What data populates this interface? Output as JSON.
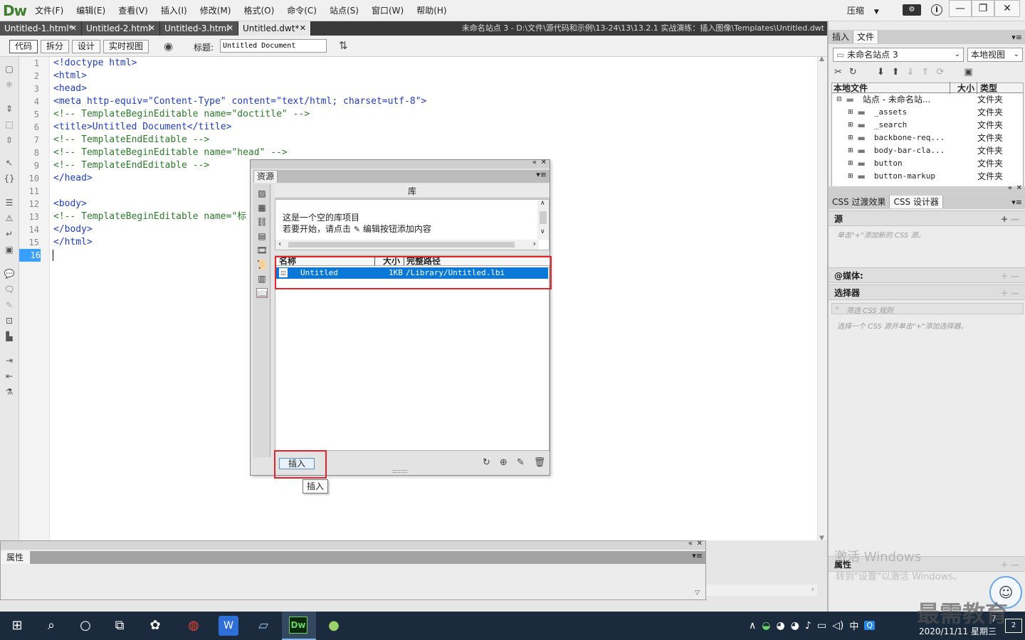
{
  "app": {
    "logo": "Dw",
    "menu": [
      "文件(F)",
      "编辑(E)",
      "查看(V)",
      "插入(I)",
      "修改(M)",
      "格式(O)",
      "命令(C)",
      "站点(S)",
      "窗口(W)",
      "帮助(H)"
    ],
    "compress_label": "压缩",
    "window_buttons": [
      "—",
      "❐",
      "✕"
    ]
  },
  "tabs": [
    {
      "label": "Untitled-1.html*"
    },
    {
      "label": "Untitled-2.html"
    },
    {
      "label": "Untitled-3.html"
    },
    {
      "label": "Untitled.dwt*"
    }
  ],
  "path_info": "未命名站点 3 - D:\\文件\\源代码和示例\\13-24\\13\\13.2.1  实战演练：插入图像\\Templates\\Untitled.dwt",
  "doc_toolbar": {
    "views": [
      "代码",
      "拆分",
      "设计",
      "实时视图"
    ],
    "title_label": "标题:",
    "title_value": "Untitled Document"
  },
  "code_lines": [
    {
      "n": "1",
      "text": "<!doctype html>",
      "kind": "t"
    },
    {
      "n": "2",
      "text": "<html>",
      "kind": "t"
    },
    {
      "n": "3",
      "text": "<head>",
      "kind": "t"
    },
    {
      "n": "4",
      "text": "<meta http-equiv=\"Content-Type\" content=\"text/html; charset=utf-8\">",
      "kind": "t"
    },
    {
      "n": "5",
      "text": "<!-- TemplateBeginEditable name=\"doctitle\" -->",
      "kind": "c"
    },
    {
      "n": "6",
      "text": "<title>Untitled Document</title>",
      "kind": "t"
    },
    {
      "n": "7",
      "text": "<!-- TemplateEndEditable -->",
      "kind": "c"
    },
    {
      "n": "8",
      "text": "<!-- TemplateBeginEditable name=\"head\" -->",
      "kind": "c"
    },
    {
      "n": "9",
      "text": "<!-- TemplateEndEditable -->",
      "kind": "c"
    },
    {
      "n": "10",
      "text": "</head>",
      "kind": "t"
    },
    {
      "n": "11",
      "text": "",
      "kind": "t"
    },
    {
      "n": "12",
      "text": "<body>",
      "kind": "t"
    },
    {
      "n": "13",
      "text": "<!-- TemplateBeginEditable name=\"标",
      "kind": "c"
    },
    {
      "n": "14",
      "text": "</body>",
      "kind": "t"
    },
    {
      "n": "15",
      "text": "</html>",
      "kind": "t"
    },
    {
      "n": "16",
      "text": "",
      "kind": "t"
    }
  ],
  "properties_panel": {
    "tab": "属性"
  },
  "assets_panel": {
    "tab": "资源",
    "library_header": "库",
    "preview_line1": "这是一个空的库项目",
    "preview_line2a": "若要开始，请点击",
    "preview_line2b": "编辑按钮添加内容",
    "columns": [
      "名称",
      "大小",
      "完整路径"
    ],
    "item": {
      "name": "Untitled",
      "size": "1KB",
      "path": "/Library/Untitled.lbi"
    },
    "insert_button": "插入",
    "tooltip": "插入"
  },
  "right_panel": {
    "tabs": [
      "插入",
      "文件"
    ],
    "site_select": "未命名站点 3",
    "view_select": "本地视图",
    "file_columns": [
      "本地文件",
      "大小",
      "类型"
    ],
    "root": {
      "name": "站点 - 未命名站...",
      "type": "文件夹"
    },
    "folders": [
      {
        "name": "_assets",
        "type": "文件夹"
      },
      {
        "name": "_search",
        "type": "文件夹"
      },
      {
        "name": "backbone-req...",
        "type": "文件夹"
      },
      {
        "name": "body-bar-cla...",
        "type": "文件夹"
      },
      {
        "name": "button",
        "type": "文件夹"
      },
      {
        "name": "button-markup",
        "type": "文件夹"
      }
    ],
    "css_tabs": [
      "CSS 过渡效果",
      "CSS 设计器"
    ],
    "source_section": "源",
    "source_hint": "单击\"+\"添加新的 CSS 源。",
    "media_section": "@媒体:",
    "selector_section": "选择器",
    "selector_filter": "筛选 CSS 规则",
    "selector_hint": "选择一个 CSS 源并单击\"+\"添加选择器。",
    "props_section": "属性"
  },
  "watermark": {
    "line1": "激活 Windows",
    "line2": "转到\"设置\"以激活 Windows。",
    "brand": "最需教育"
  },
  "taskbar": {
    "ime": "中",
    "time": "7",
    "date": "2020/11/11 星期三",
    "badge": "2"
  }
}
